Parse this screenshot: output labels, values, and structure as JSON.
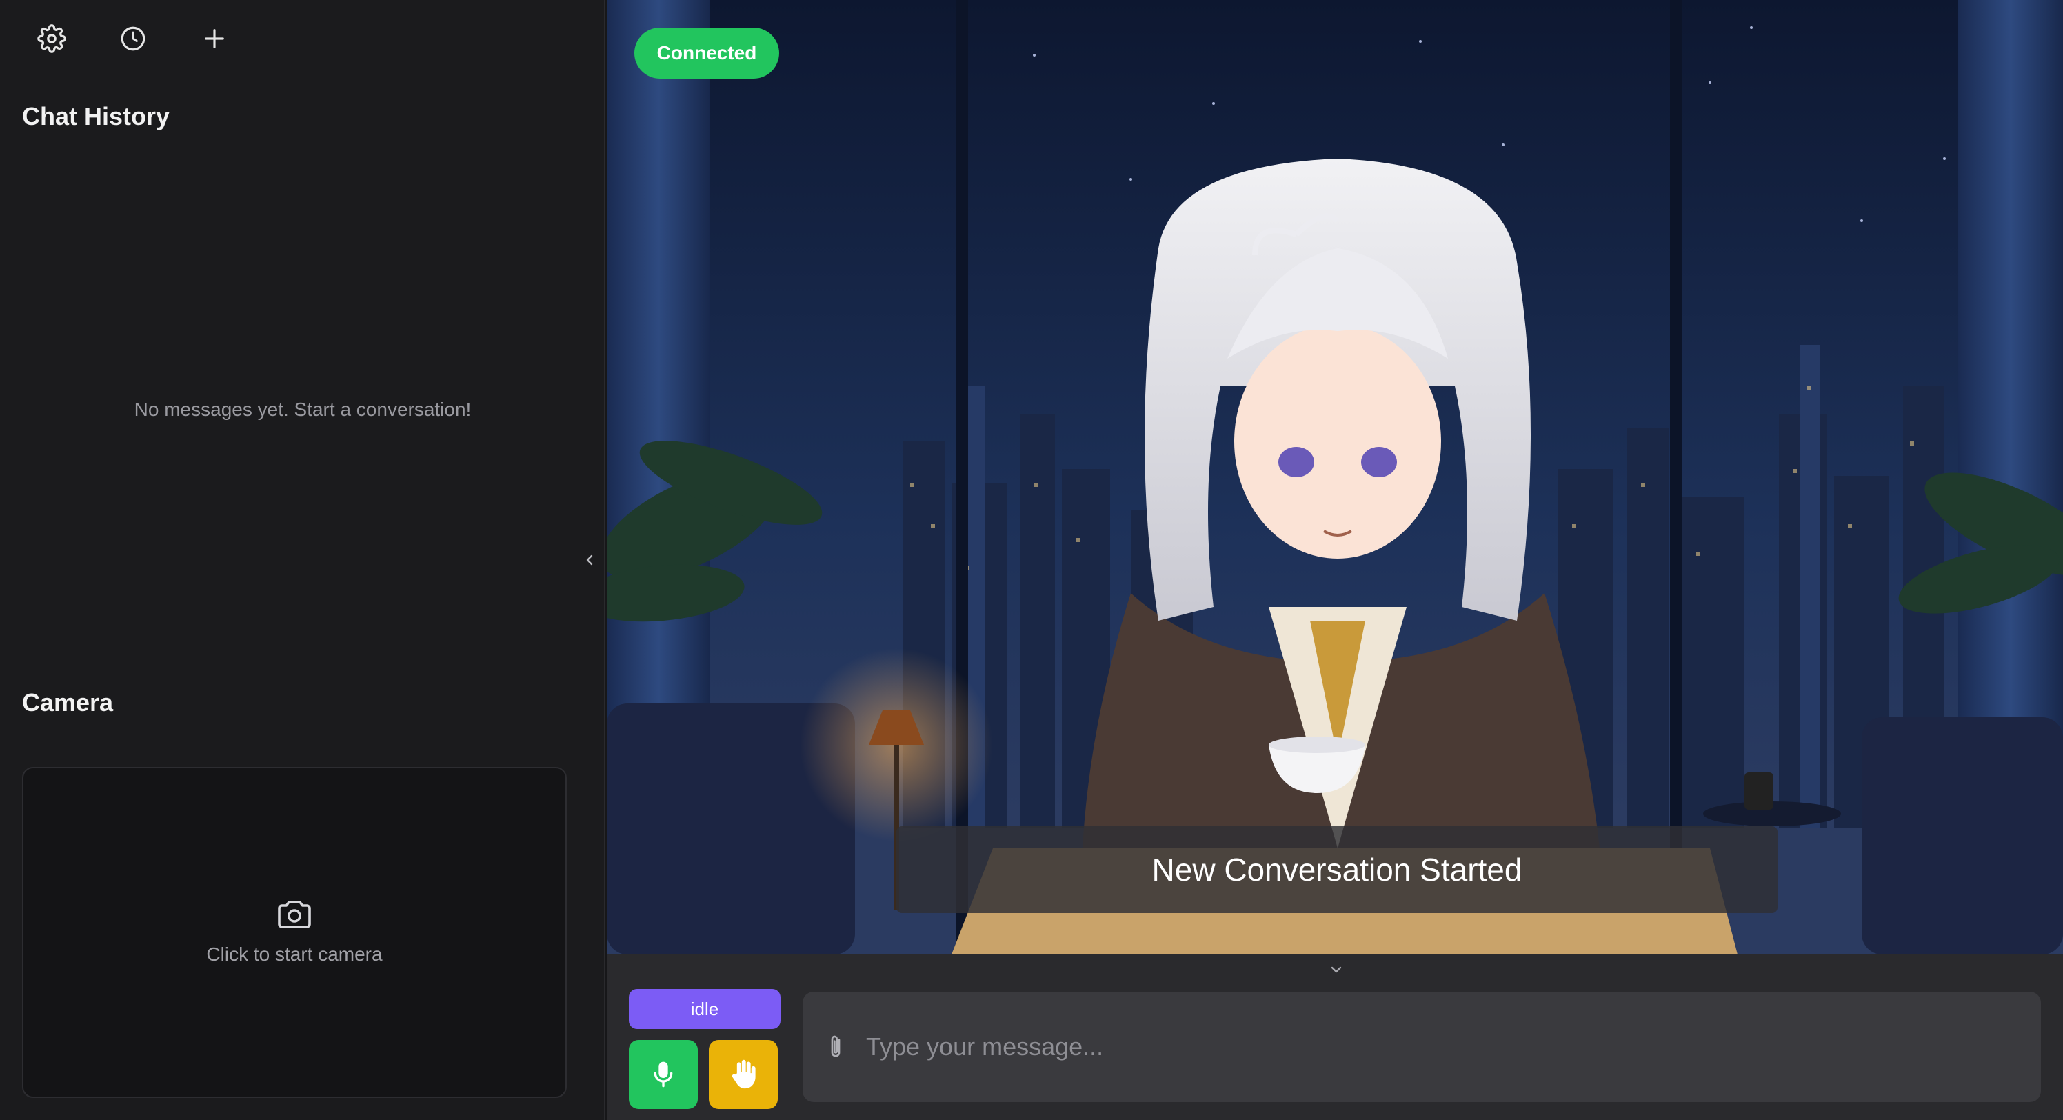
{
  "sidebar": {
    "toolbar": [
      {
        "icon": "gear-icon"
      },
      {
        "icon": "clock-icon"
      },
      {
        "icon": "plus-icon"
      }
    ],
    "chat_history_title": "Chat History",
    "empty_message": "No messages yet. Start a conversation!",
    "camera_title": "Camera",
    "camera_prompt": "Click to start camera"
  },
  "stage": {
    "connection_status": "Connected",
    "subtitle": "New Conversation Started"
  },
  "controls": {
    "state": "idle",
    "message_placeholder": "Type your message..."
  },
  "colors": {
    "connected": "#22c55e",
    "idle": "#7c5cf5",
    "mic": "#22c55e",
    "interrupt": "#eab308"
  }
}
